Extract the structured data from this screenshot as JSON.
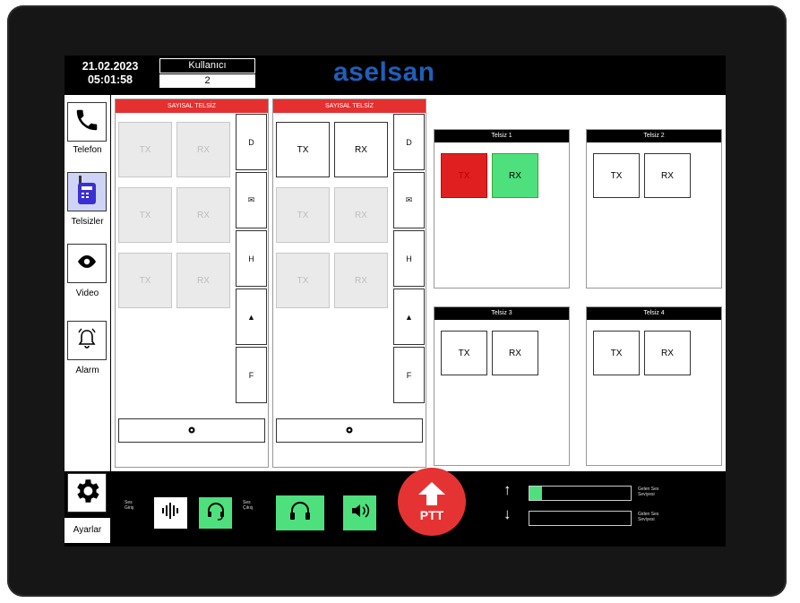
{
  "header": {
    "date": "21.02.2023",
    "time": "05:01:58",
    "user_label": "Kullanıcı",
    "user_value": "2",
    "logo": "aselsan"
  },
  "sidebar": {
    "items": [
      {
        "label": "Telefon",
        "icon": "phone-icon"
      },
      {
        "label": "Telsizler",
        "icon": "radio-icon",
        "active": true
      },
      {
        "label": "Video",
        "icon": "eye-icon"
      },
      {
        "label": "Alarm",
        "icon": "alarm-bell-icon"
      }
    ],
    "settings_label": "Ayarlar"
  },
  "digital_panels": [
    {
      "title": "SAYISAL TELSİZ",
      "rows": [
        {
          "tx": "TX",
          "rx": "RX",
          "enabled": false
        },
        {
          "tx": "TX",
          "rx": "RX",
          "enabled": false
        },
        {
          "tx": "TX",
          "rx": "RX",
          "enabled": false
        }
      ],
      "side_buttons": [
        "D",
        "✉",
        "H",
        "▲",
        "F"
      ]
    },
    {
      "title": "SAYISAL TELSİZ",
      "rows": [
        {
          "tx": "TX",
          "rx": "RX",
          "enabled": true
        },
        {
          "tx": "TX",
          "rx": "RX",
          "enabled": false
        },
        {
          "tx": "TX",
          "rx": "RX",
          "enabled": false
        }
      ],
      "side_buttons": [
        "D",
        "✉",
        "H",
        "▲",
        "F"
      ]
    }
  ],
  "radios": [
    {
      "title": "Telsiz 1",
      "tx": "TX",
      "rx": "RX",
      "tx_state": "red",
      "rx_state": "green"
    },
    {
      "title": "Telsiz 2",
      "tx": "TX",
      "rx": "RX",
      "tx_state": "normal",
      "rx_state": "normal"
    },
    {
      "title": "Telsiz 3",
      "tx": "TX",
      "rx": "RX",
      "tx_state": "normal",
      "rx_state": "normal"
    },
    {
      "title": "Telsiz 4",
      "tx": "TX",
      "rx": "RX",
      "tx_state": "normal",
      "rx_state": "normal"
    }
  ],
  "footer": {
    "audio_in_label": "Ses Giriş",
    "audio_out_label": "Ses Çıkış",
    "ptt_label": "PTT",
    "incoming_level_label": "Gelen Ses Seviyesi",
    "outgoing_level_label": "Giden Ses Seviyesi",
    "incoming_level": 0.12,
    "outgoing_level": 0.0
  },
  "colors": {
    "accent_red": "#e53030",
    "green": "#4ee07c",
    "logo_blue": "#1f5fb8"
  }
}
